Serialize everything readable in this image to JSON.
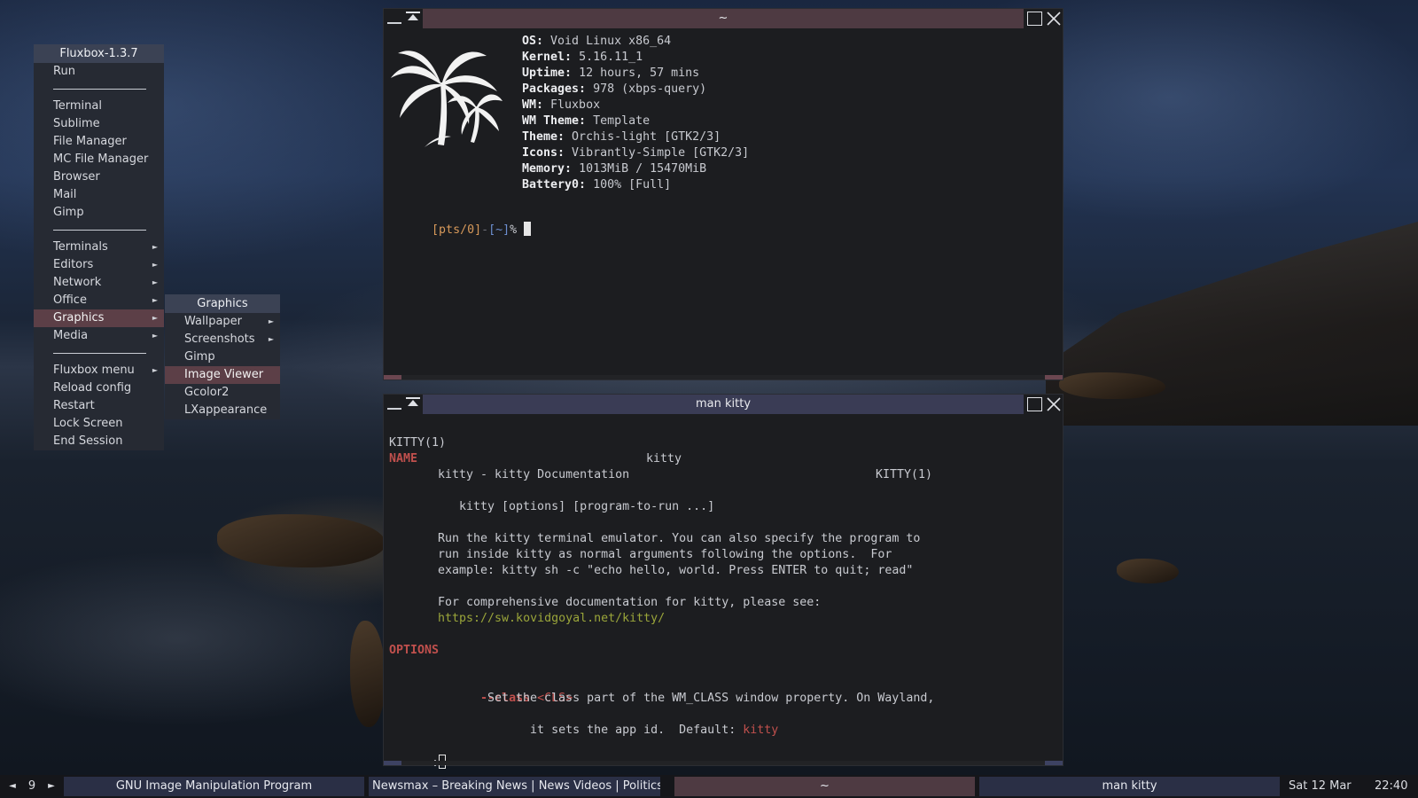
{
  "menu": {
    "title": "Fluxbox-1.3.7",
    "items": [
      {
        "type": "item",
        "label": "Run"
      },
      {
        "type": "sep"
      },
      {
        "type": "item",
        "label": "Terminal"
      },
      {
        "type": "item",
        "label": "Sublime"
      },
      {
        "type": "item",
        "label": "File Manager"
      },
      {
        "type": "item",
        "label": "MC File Manager"
      },
      {
        "type": "item",
        "label": "Browser"
      },
      {
        "type": "item",
        "label": "Mail"
      },
      {
        "type": "item",
        "label": "Gimp"
      },
      {
        "type": "sep"
      },
      {
        "type": "item",
        "label": "Terminals",
        "submenu": true
      },
      {
        "type": "item",
        "label": "Editors",
        "submenu": true
      },
      {
        "type": "item",
        "label": "Network",
        "submenu": true
      },
      {
        "type": "item",
        "label": "Office",
        "submenu": true
      },
      {
        "type": "item",
        "label": "Graphics",
        "submenu": true,
        "active": true
      },
      {
        "type": "item",
        "label": "Media",
        "submenu": true
      },
      {
        "type": "sep"
      },
      {
        "type": "item",
        "label": "Fluxbox menu",
        "submenu": true
      },
      {
        "type": "item",
        "label": "Reload config"
      },
      {
        "type": "item",
        "label": "Restart"
      },
      {
        "type": "item",
        "label": "Lock Screen"
      },
      {
        "type": "item",
        "label": "End Session"
      }
    ],
    "submenu_arrow": "►"
  },
  "submenu": {
    "title": "Graphics",
    "items": [
      {
        "label": "Wallpaper",
        "submenu": true
      },
      {
        "label": "Screenshots",
        "submenu": true
      },
      {
        "label": "Gimp"
      },
      {
        "label": "Image Viewer",
        "active": true
      },
      {
        "label": "Gcolor2"
      },
      {
        "label": "LXappearance"
      }
    ]
  },
  "term1": {
    "title": "~",
    "fetch": [
      {
        "key": "OS",
        "value": " Void Linux x86_64"
      },
      {
        "key": "Kernel",
        "value": " 5.16.11_1"
      },
      {
        "key": "Uptime",
        "value": " 12 hours, 57 mins"
      },
      {
        "key": "Packages",
        "value": " 978 (xbps-query)"
      },
      {
        "key": "WM",
        "value": " Fluxbox"
      },
      {
        "key": "WM Theme",
        "value": " Template"
      },
      {
        "key": "Theme",
        "value": " Orchis-light [GTK2/3]"
      },
      {
        "key": "Icons",
        "value": " Vibrantly-Simple [GTK2/3]"
      },
      {
        "key": "Memory",
        "value": " 1013MiB / 15470MiB"
      },
      {
        "key": "Battery0",
        "value": " 100% [Full]"
      }
    ],
    "prompt_tty": "[pts/0]",
    "prompt_sep": "-",
    "prompt_dir": "[~]",
    "prompt_char": "%"
  },
  "term2": {
    "title": "man kitty",
    "header_left": "KITTY(1)",
    "header_center": "kitty",
    "header_right": "KITTY(1)",
    "name_heading": "NAME",
    "name_desc": "kitty - kitty Documentation",
    "synopsis": "kitty [options] [program-to-run ...]",
    "para1": [
      "Run the kitty terminal emulator. You can also specify the program to",
      "run inside kitty as normal arguments following the options.  For",
      "example: kitty sh -c \"echo hello, world. Press ENTER to quit; read\""
    ],
    "para2": "For comprehensive documentation for kitty, please see:",
    "link": "https://sw.kovidgoyal.net/kitty/",
    "options_heading": "OPTIONS",
    "opt_flag": "--class",
    "opt_arg": "<CLS>",
    "opt_desc1": "Set the class part of the WM_CLASS window property. On Wayland,",
    "opt_desc2_pre": "it sets the app id.  Default: ",
    "opt_default": "kitty",
    "pager_prompt": ":"
  },
  "toolbar": {
    "prev_arrow": "◄",
    "workspace": "9",
    "next_arrow": "►",
    "tasks": [
      {
        "label": "GNU Image Manipulation Program"
      },
      {
        "label": "Newsmax – Breaking News | News Videos | Politics,"
      },
      {
        "label": "~",
        "focused": true
      },
      {
        "label": "man kitty"
      }
    ],
    "date": "Sat 12 Mar",
    "time": "22:40"
  },
  "colors": {
    "accent_title": "#4e3a42",
    "accent_title2": "#3a3c55",
    "term_key": "#e8e9ec",
    "prompt_tty": "#d7995a",
    "prompt_dir": "#6d8fd0",
    "man_heading": "#c0504d",
    "link": "#9aa53a"
  }
}
